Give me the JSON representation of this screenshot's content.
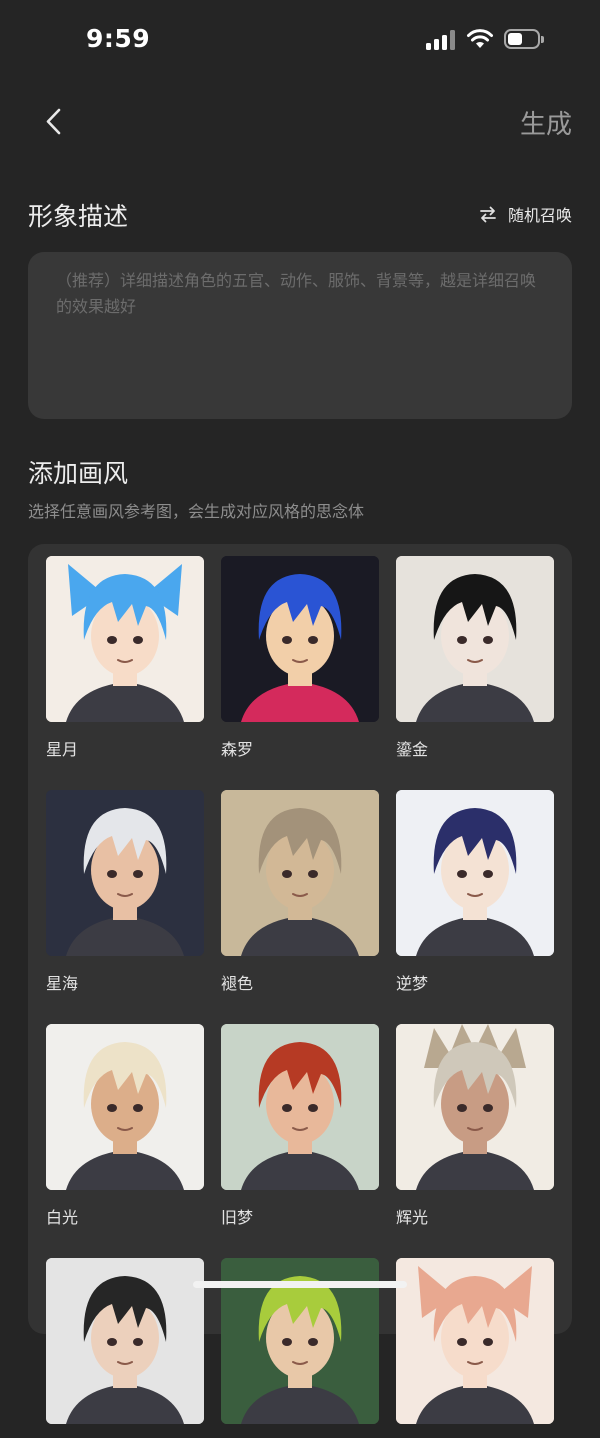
{
  "status_bar": {
    "time": "9:59"
  },
  "nav": {
    "generate_label": "生成"
  },
  "description": {
    "title": "形象描述",
    "random_label": "随机召唤",
    "placeholder": "（推荐）详细描述角色的五官、动作、服饰、背景等，越是详细召唤的效果越好"
  },
  "style": {
    "title": "添加画风",
    "subtitle": "选择任意画风参考图，会生成对应风格的思念体",
    "items": [
      {
        "label": "星月",
        "hair": "#4aa7ee",
        "bg": "#f3ede6",
        "skin": "#f7dcc8",
        "ears": true
      },
      {
        "label": "森罗",
        "hair": "#2a54d4",
        "bg": "#1a1a24",
        "skin": "#f2cfa9",
        "scarf": "#d42a5c"
      },
      {
        "label": "鎏金",
        "hair": "#161616",
        "bg": "#e6e2dc",
        "skin": "#f0e4dc"
      },
      {
        "label": "星海",
        "hair": "#e4e6ea",
        "bg": "#2c3040",
        "skin": "#e8c0a4"
      },
      {
        "label": "褪色",
        "hair": "#a3927a",
        "bg": "#c8b89a",
        "skin": "#d2b896"
      },
      {
        "label": "逆梦",
        "hair": "#2b2f6a",
        "bg": "#eef0f4",
        "skin": "#f4e2d4"
      },
      {
        "label": "白光",
        "hair": "#ede2c8",
        "bg": "#f0efec",
        "skin": "#dcae8a"
      },
      {
        "label": "旧梦",
        "hair": "#b63a24",
        "bg": "#c8d4c8",
        "skin": "#e8b89a"
      },
      {
        "label": "辉光",
        "hair": "#cfc8ba",
        "bg": "#f1ece4",
        "skin": "#c89c84",
        "crown": true
      },
      {
        "label": "",
        "hair": "#262626",
        "bg": "#e4e4e4",
        "skin": "#ecd0bc"
      },
      {
        "label": "",
        "hair": "#a8cc3c",
        "bg": "#3a5e3e",
        "skin": "#e8c8a8"
      },
      {
        "label": "",
        "hair": "#e8a890",
        "bg": "#f4e8e0",
        "skin": "#f6dccb",
        "ears": true
      }
    ]
  }
}
